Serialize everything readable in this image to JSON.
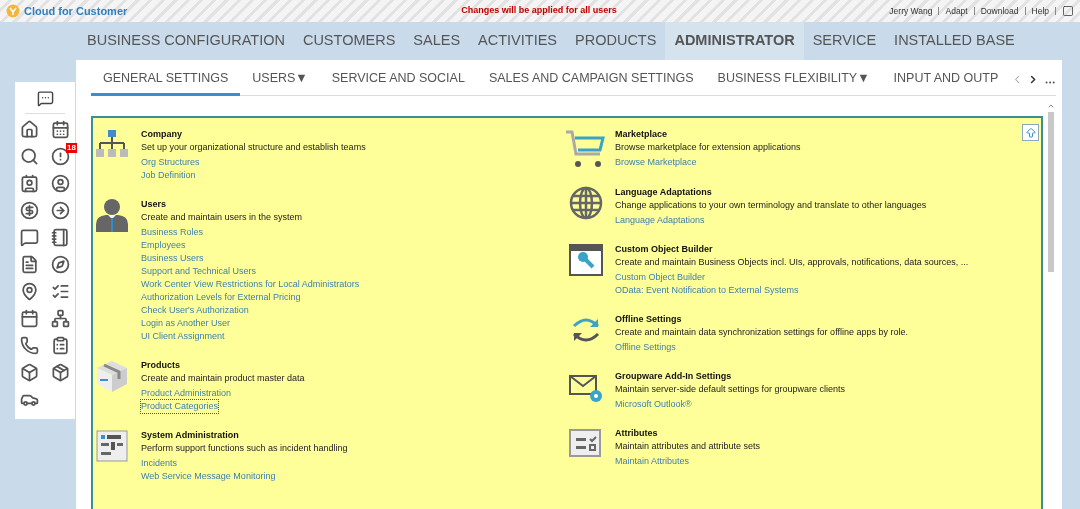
{
  "header": {
    "app_name": "Cloud for Customer",
    "notice": "Changes will be applied for all users",
    "links": [
      "Jerry Wang",
      "Adapt",
      "Download",
      "Help"
    ]
  },
  "nav": [
    {
      "label": "BUSINESS CONFIGURATION",
      "selected": false
    },
    {
      "label": "CUSTOMERS",
      "selected": false
    },
    {
      "label": "SALES",
      "selected": false
    },
    {
      "label": "ACTIVITIES",
      "selected": false
    },
    {
      "label": "PRODUCTS",
      "selected": false
    },
    {
      "label": "ADMINISTRATOR",
      "selected": true
    },
    {
      "label": "SERVICE",
      "selected": false
    },
    {
      "label": "INSTALLED BASE",
      "selected": false
    }
  ],
  "subtabs": [
    {
      "label": "GENERAL SETTINGS",
      "selected": true
    },
    {
      "label": "USERS▼",
      "selected": false
    },
    {
      "label": "SERVICE AND SOCIAL",
      "selected": false
    },
    {
      "label": "SALES AND CAMPAIGN SETTINGS",
      "selected": false
    },
    {
      "label": "BUSINESS FLEXIBILITY▼",
      "selected": false
    },
    {
      "label": "INPUT AND OUTP",
      "selected": false
    }
  ],
  "sidebar": {
    "badge": "18"
  },
  "columns": [
    [
      {
        "kind": "org",
        "title": "Company",
        "description": "Set up your organizational structure and establish teams",
        "links": [
          {
            "label": "Org Structures",
            "focused": false
          },
          {
            "label": "Job Definition",
            "focused": false
          }
        ]
      },
      {
        "kind": "user",
        "title": "Users",
        "description": "Create and maintain users in the system",
        "links": [
          {
            "label": "Business Roles",
            "focused": false
          },
          {
            "label": "Employees",
            "focused": false
          },
          {
            "label": "Business Users",
            "focused": false
          },
          {
            "label": "Support and Technical Users",
            "focused": false
          },
          {
            "label": "Work Center View Restrictions for Local Administrators",
            "focused": false
          },
          {
            "label": "Authorization Levels for External Pricing",
            "focused": false
          },
          {
            "label": "Check User's Authorization",
            "focused": false
          },
          {
            "label": "Login as Another User",
            "focused": false
          },
          {
            "label": "UI Client Assignment",
            "focused": false
          }
        ]
      },
      {
        "kind": "box",
        "title": "Products",
        "description": "Create and maintain product master data",
        "links": [
          {
            "label": "Product Administration",
            "focused": false
          },
          {
            "label": "Product Categories",
            "focused": true
          }
        ]
      },
      {
        "kind": "form",
        "title": "System Administration",
        "description": "Perform support functions such as incident handling",
        "links": [
          {
            "label": "Incidents",
            "focused": false
          },
          {
            "label": "Web Service Message Monitoring",
            "focused": false
          }
        ]
      }
    ],
    [
      {
        "kind": "cart",
        "title": "Marketplace",
        "description": "Browse marketplace for extension applications",
        "links": [
          {
            "label": "Browse Marketplace",
            "focused": false
          }
        ]
      },
      {
        "kind": "globe",
        "title": "Language Adaptations",
        "description": "Change applications to your own terminology and translate to other languages",
        "links": [
          {
            "label": "Language Adaptations",
            "focused": false
          }
        ]
      },
      {
        "kind": "builder",
        "title": "Custom Object Builder",
        "description": "Create and maintain Business Objects incl. UIs, approvals, notifications, data sources, ...",
        "links": [
          {
            "label": "Custom Object Builder",
            "focused": false
          },
          {
            "label": "OData: Event Notification to External Systems",
            "focused": false
          }
        ]
      },
      {
        "kind": "sync",
        "title": "Offline Settings",
        "description": "Create and maintain data synchronization settings for offline apps by role.",
        "links": [
          {
            "label": "Offline Settings",
            "focused": false
          }
        ]
      },
      {
        "kind": "mail",
        "title": "Groupware Add-In Settings",
        "description": "Maintain server-side default settings for groupware clients",
        "links": [
          {
            "label": "Microsoft Outlook®",
            "focused": false
          }
        ]
      },
      {
        "kind": "attributes",
        "title": "Attributes",
        "description": "Maintain attributes and attribute sets",
        "links": [
          {
            "label": "Maintain Attributes",
            "focused": false
          }
        ]
      }
    ]
  ]
}
